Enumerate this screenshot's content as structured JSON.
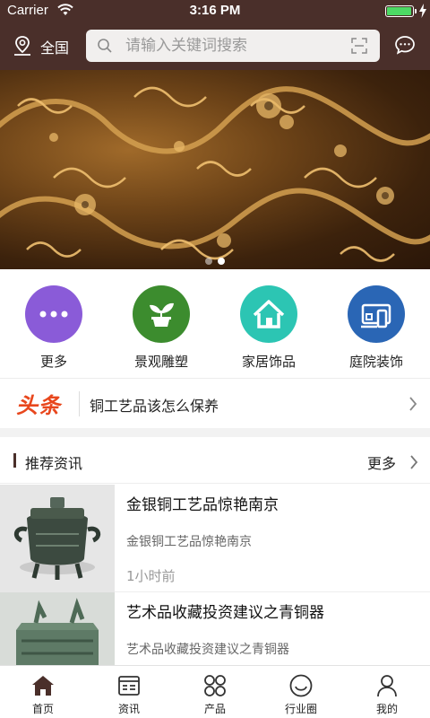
{
  "status_bar": {
    "carrier": "Carrier",
    "time": "3:16 PM",
    "battery_level": 1.0
  },
  "header": {
    "location_label": "全国",
    "search_placeholder": "请输入关键词搜索",
    "icons": [
      "location-pin-icon",
      "search-icon",
      "scan-icon",
      "message-icon"
    ]
  },
  "banner": {
    "slide_count": 2,
    "active_slide": 2
  },
  "categories": [
    {
      "label": "更多",
      "icon": "more-dots-icon",
      "color": "#8a5bd8"
    },
    {
      "label": "景观雕塑",
      "icon": "plant-pot-icon",
      "color": "#3c8c2e"
    },
    {
      "label": "家居饰品",
      "icon": "home-icon",
      "color": "#2cc5b3"
    },
    {
      "label": "庭院装饰",
      "icon": "garden-device-icon",
      "color": "#2a66b5"
    }
  ],
  "headline": {
    "tag": "头条",
    "text": "铜工艺品该怎么保养"
  },
  "section": {
    "title": "推荐资讯",
    "more_label": "更多"
  },
  "news": [
    {
      "title": "金银铜工艺品惊艳南京",
      "summary": "金银铜工艺品惊艳南京",
      "time": "1小时前"
    },
    {
      "title": "艺术品收藏投资建议之青铜器",
      "summary": "艺术品收藏投资建议之青铜器",
      "time": ""
    }
  ],
  "tabs": [
    {
      "label": "首页",
      "icon": "home-tab-icon",
      "active": true
    },
    {
      "label": "资讯",
      "icon": "news-tab-icon",
      "active": false
    },
    {
      "label": "产品",
      "icon": "product-grid-icon",
      "active": false
    },
    {
      "label": "行业圈",
      "icon": "smile-circle-icon",
      "active": false
    },
    {
      "label": "我的",
      "icon": "user-icon",
      "active": false
    }
  ],
  "colors": {
    "header_bg": "#4a2f2a",
    "headline_tag": "#e8471d",
    "active_tab": "#4a2f2a"
  }
}
